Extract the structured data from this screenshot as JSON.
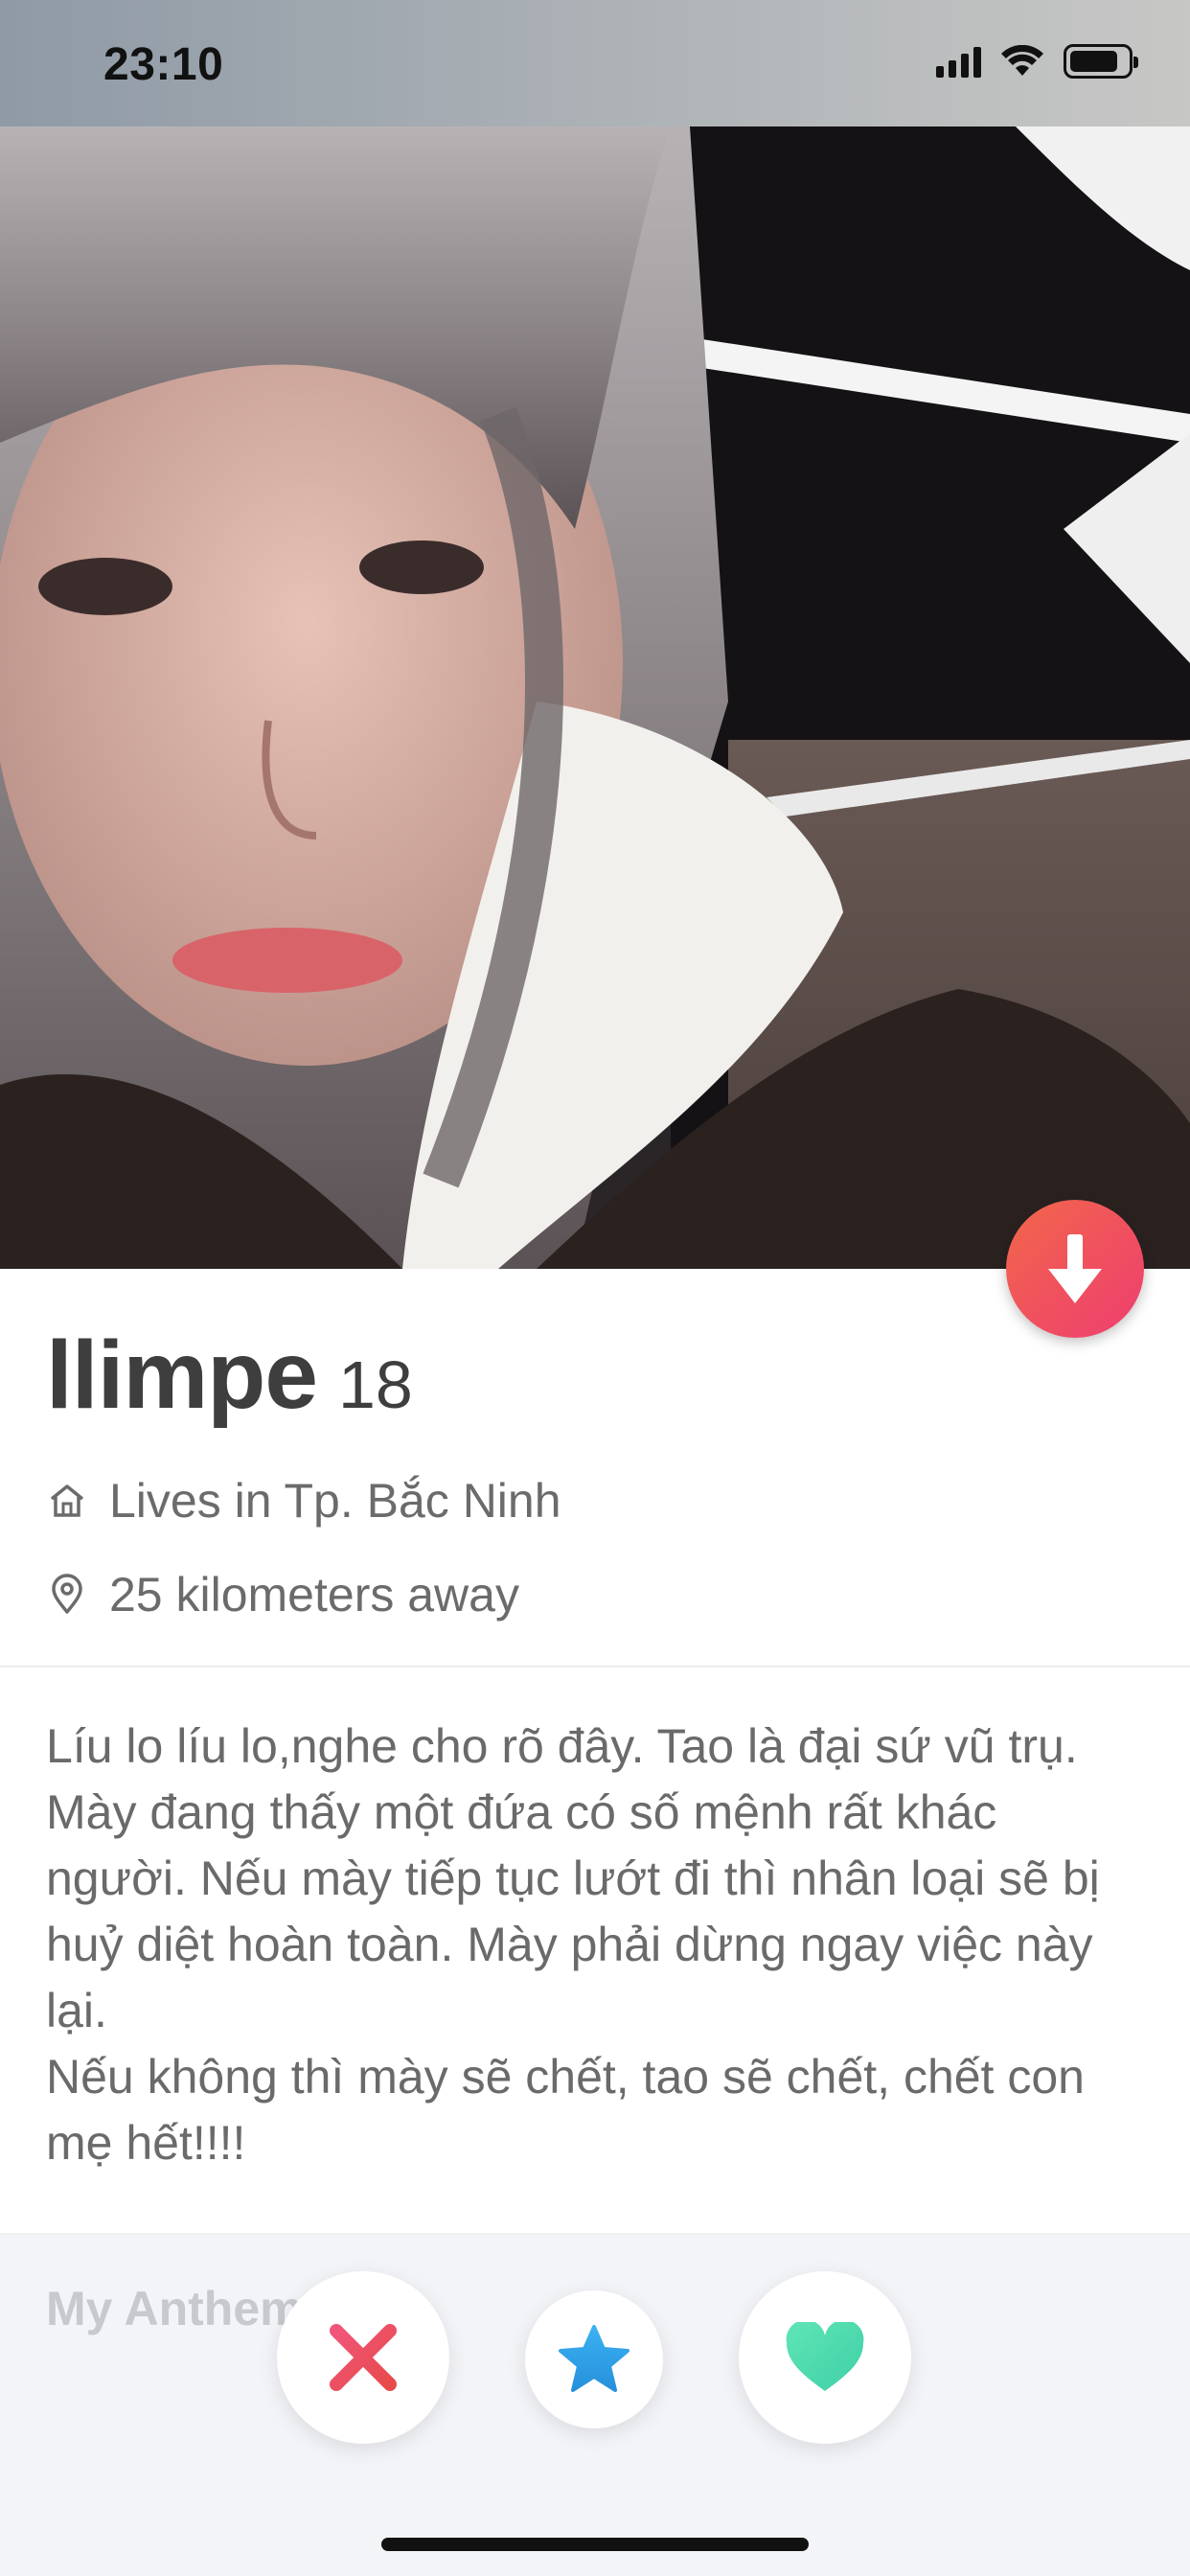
{
  "status_bar": {
    "time": "23:10",
    "icons": [
      "cellular-signal-icon",
      "wifi-icon",
      "battery-icon"
    ],
    "battery_level": 0.85
  },
  "photo": {
    "description_icon": "profile-photo"
  },
  "profile": {
    "name": "llimpe",
    "age": "18",
    "lives_in": "Lives in Tp. Bắc Ninh",
    "distance": "25 kilometers away",
    "bio_lines": [
      "Líu lo líu lo,nghe cho rõ đây. Tao là đại sứ vũ trụ. Mày đang thấy một đứa có số mệnh rất khác người. Nếu mày tiếp tục lướt đi thì nhân loại sẽ bị huỷ diệt hoàn toàn. Mày phải dừng ngay việc này lại.",
      "Nếu không thì mày sẽ chết, tao sẽ chết, chết con mẹ hết!!!!"
    ],
    "section_next": "My Anthem"
  },
  "actions": {
    "collapse": "arrow-down-icon",
    "nope": "close-icon",
    "super_like": "star-icon",
    "like": "heart-icon"
  },
  "colors": {
    "accent_gradient_start": "#f2664a",
    "accent_gradient_end": "#ee3e70",
    "nope": "#ee4b5f",
    "star": "#2fa3ea",
    "like": "#4fdcb0"
  }
}
